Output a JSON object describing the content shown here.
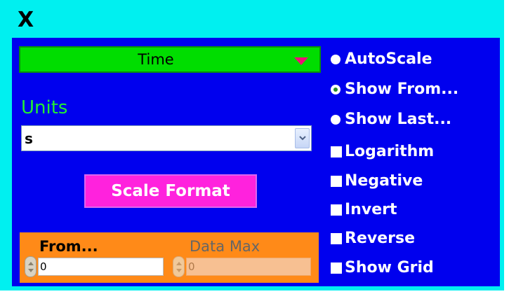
{
  "window": {
    "title": "X"
  },
  "scale": {
    "quantity_select": {
      "value": "Time",
      "arrow_color": "#ee1177"
    },
    "units": {
      "label": "Units",
      "value": "s"
    },
    "scale_format_button": {
      "label": "Scale Format"
    },
    "range": {
      "from_label": "From...",
      "from_value": "0",
      "max_label": "Data Max",
      "max_value": "0"
    }
  },
  "options": [
    {
      "label": "AutoScale",
      "type": "radio",
      "selected": false
    },
    {
      "label": "Show From...",
      "type": "radio",
      "selected": true
    },
    {
      "label": "Show Last...",
      "type": "radio",
      "selected": false
    },
    {
      "label": "Logarithm",
      "type": "checkbox",
      "checked": false
    },
    {
      "label": "Negative",
      "type": "checkbox",
      "checked": false
    },
    {
      "label": "Invert",
      "type": "checkbox",
      "checked": false
    },
    {
      "label": "Reverse",
      "type": "checkbox",
      "checked": false
    },
    {
      "label": "Show Grid",
      "type": "checkbox",
      "checked": false
    }
  ],
  "colors": {
    "frame": "#00f0f0",
    "panel": "#0000ee",
    "select": "#00dd00",
    "units_label": "#22ee33",
    "button": "#ff22dd",
    "range_panel": "#ff8a18"
  }
}
